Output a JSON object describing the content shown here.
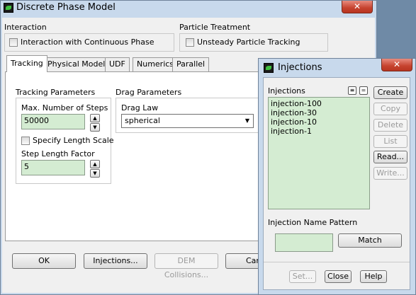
{
  "dpm": {
    "title": "Discrete Phase Model",
    "interaction_label": "Interaction",
    "interaction_checkbox": "Interaction with Continuous Phase",
    "particle_treatment_label": "Particle Treatment",
    "unsteady_checkbox": "Unsteady Particle Tracking",
    "tabs": [
      "Tracking",
      "Physical Models",
      "UDF",
      "Numerics",
      "Parallel"
    ],
    "tracking_params_label": "Tracking Parameters",
    "max_steps_label": "Max. Number of Steps",
    "max_steps_value": "50000",
    "specify_length_label": "Specify Length Scale",
    "step_factor_label": "Step Length Factor",
    "step_factor_value": "5",
    "drag_params_label": "Drag Parameters",
    "drag_law_label": "Drag Law",
    "drag_law_value": "spherical",
    "buttons": {
      "ok": "OK",
      "injections": "Injections...",
      "dem": "DEM Collisions...",
      "cancel_partial": "Can"
    }
  },
  "injections": {
    "title": "Injections",
    "list_label": "Injections",
    "items": [
      "injection-100",
      "injection-30",
      "injection-10",
      "injection-1"
    ],
    "side_buttons": {
      "create": "Create",
      "copy": "Copy",
      "delete": "Delete",
      "list": "List",
      "read": "Read...",
      "write": "Write..."
    },
    "pattern_label": "Injection Name Pattern",
    "pattern_value": "",
    "match": "Match",
    "bottom_buttons": {
      "set": "Set...",
      "close": "Close",
      "help": "Help"
    }
  },
  "colors": {
    "frame": "#c8d9ec",
    "field_green": "#d4ecd2",
    "close_red": "#c6432f"
  }
}
